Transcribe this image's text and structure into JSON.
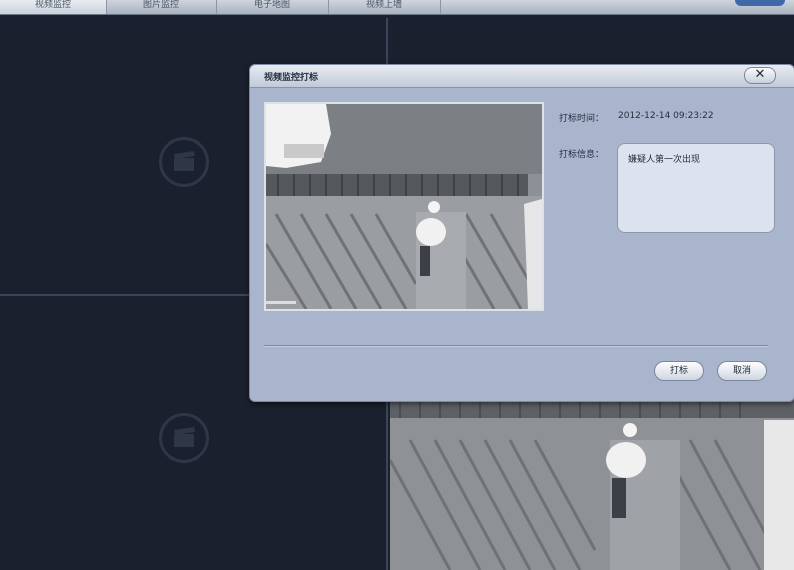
{
  "tabs": [
    "视频监控",
    "图片监控",
    "电子地图",
    "视频上墙"
  ],
  "grid": {
    "pane1": {
      "icon": "camera-icon"
    },
    "pane3": {
      "icon": "camera-icon"
    }
  },
  "dialog": {
    "title": "视频监控打标",
    "close": "✕",
    "time_label": "打标时间：",
    "time_value": "2012-12-14 09:23:22",
    "info_label": "打标信息：",
    "info_value": "嫌疑人第一次出现",
    "mark_button": "打标",
    "cancel_button": "取消"
  },
  "colors": {
    "background": "#1b2130",
    "dialog": "#a9b5cc",
    "accent": "#3f69a8"
  }
}
